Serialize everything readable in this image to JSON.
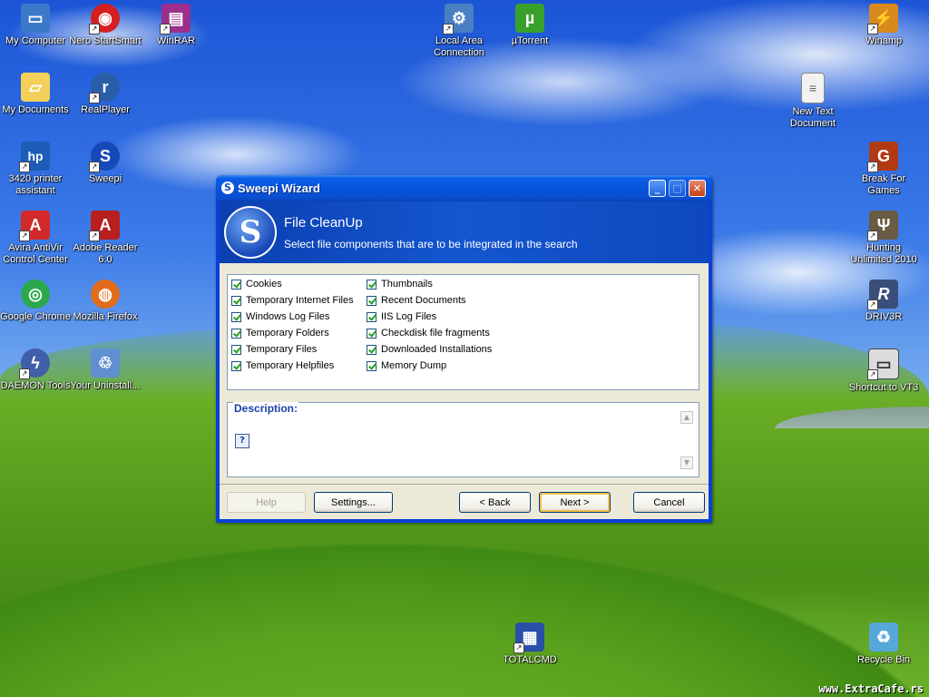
{
  "desktop": {
    "icons": [
      {
        "label": "My Computer",
        "icon": "computer-icon",
        "color": "#3c78c8"
      },
      {
        "label": "Nero StartSmart",
        "icon": "nero-icon",
        "color": "#d42020"
      },
      {
        "label": "WinRAR",
        "icon": "winrar-icon",
        "color": "#9b2f8c"
      },
      {
        "label": "Local Area Connection",
        "icon": "network-icon",
        "color": "#4a7fc4"
      },
      {
        "label": "µTorrent",
        "icon": "utorrent-icon",
        "color": "#3aa02c"
      },
      {
        "label": "Winamp",
        "icon": "winamp-icon",
        "color": "#d88a1c"
      },
      {
        "label": "My Documents",
        "icon": "folder-icon",
        "color": "#f3d05a"
      },
      {
        "label": "RealPlayer",
        "icon": "realplayer-icon",
        "color": "#2a5ea8"
      },
      {
        "label": "New Text Document",
        "icon": "text-document-icon",
        "color": "#f2f2f2"
      },
      {
        "label": "3420 printer assistant",
        "icon": "hp-icon",
        "color": "#1d5cb8"
      },
      {
        "label": "Sweepi",
        "icon": "sweepi-icon",
        "color": "#1748b8"
      },
      {
        "label": "Break For Games",
        "icon": "game-icon",
        "color": "#b13a12"
      },
      {
        "label": "Avira AntiVir Control Center",
        "icon": "avira-icon",
        "color": "#d22a2a"
      },
      {
        "label": "Adobe Reader 6.0",
        "icon": "adobe-reader-icon",
        "color": "#b81f1f"
      },
      {
        "label": "Hunting Unlimited 2010",
        "icon": "deer-icon",
        "color": "#6b5a44"
      },
      {
        "label": "Google Chrome",
        "icon": "chrome-icon",
        "color": "#2aa84b"
      },
      {
        "label": "Mozilla Firefox",
        "icon": "firefox-icon",
        "color": "#e26b1c"
      },
      {
        "label": "DRIV3R",
        "icon": "driver-icon",
        "color": "#3a4e7a"
      },
      {
        "label": "DAEMON Tools",
        "icon": "daemon-tools-icon",
        "color": "#3f5fa8"
      },
      {
        "label": "Your Uninstall...",
        "icon": "recycle-icon",
        "color": "#5f8fd0"
      },
      {
        "label": "Shortcut to VT3",
        "icon": "program-icon",
        "color": "#dcdcdc"
      },
      {
        "label": "TOTALCMD",
        "icon": "totalcmd-icon",
        "color": "#2a4fa8"
      },
      {
        "label": "Recycle Bin",
        "icon": "recycle-bin-icon",
        "color": "#55a8d8"
      }
    ],
    "watermark": "www.ExtraCafe.rs"
  },
  "window": {
    "title": "Sweepi Wizard",
    "header_title": "File CleanUp",
    "header_subtitle": "Select file components that are to be integrated in the search",
    "options_left": [
      "Cookies",
      "Temporary Internet Files",
      "Windows Log Files",
      "Temporary Folders",
      "Temporary Files",
      "Temporary Helpfiles"
    ],
    "options_right": [
      "Thumbnails",
      "Recent Documents",
      "IIS Log Files",
      "Checkdisk file fragments",
      "Downloaded Installations",
      "Memory Dump"
    ],
    "description_label": "Description:",
    "buttons": {
      "help": "Help",
      "settings": "Settings...",
      "back": "< Back",
      "next": "Next >",
      "cancel": "Cancel"
    }
  }
}
